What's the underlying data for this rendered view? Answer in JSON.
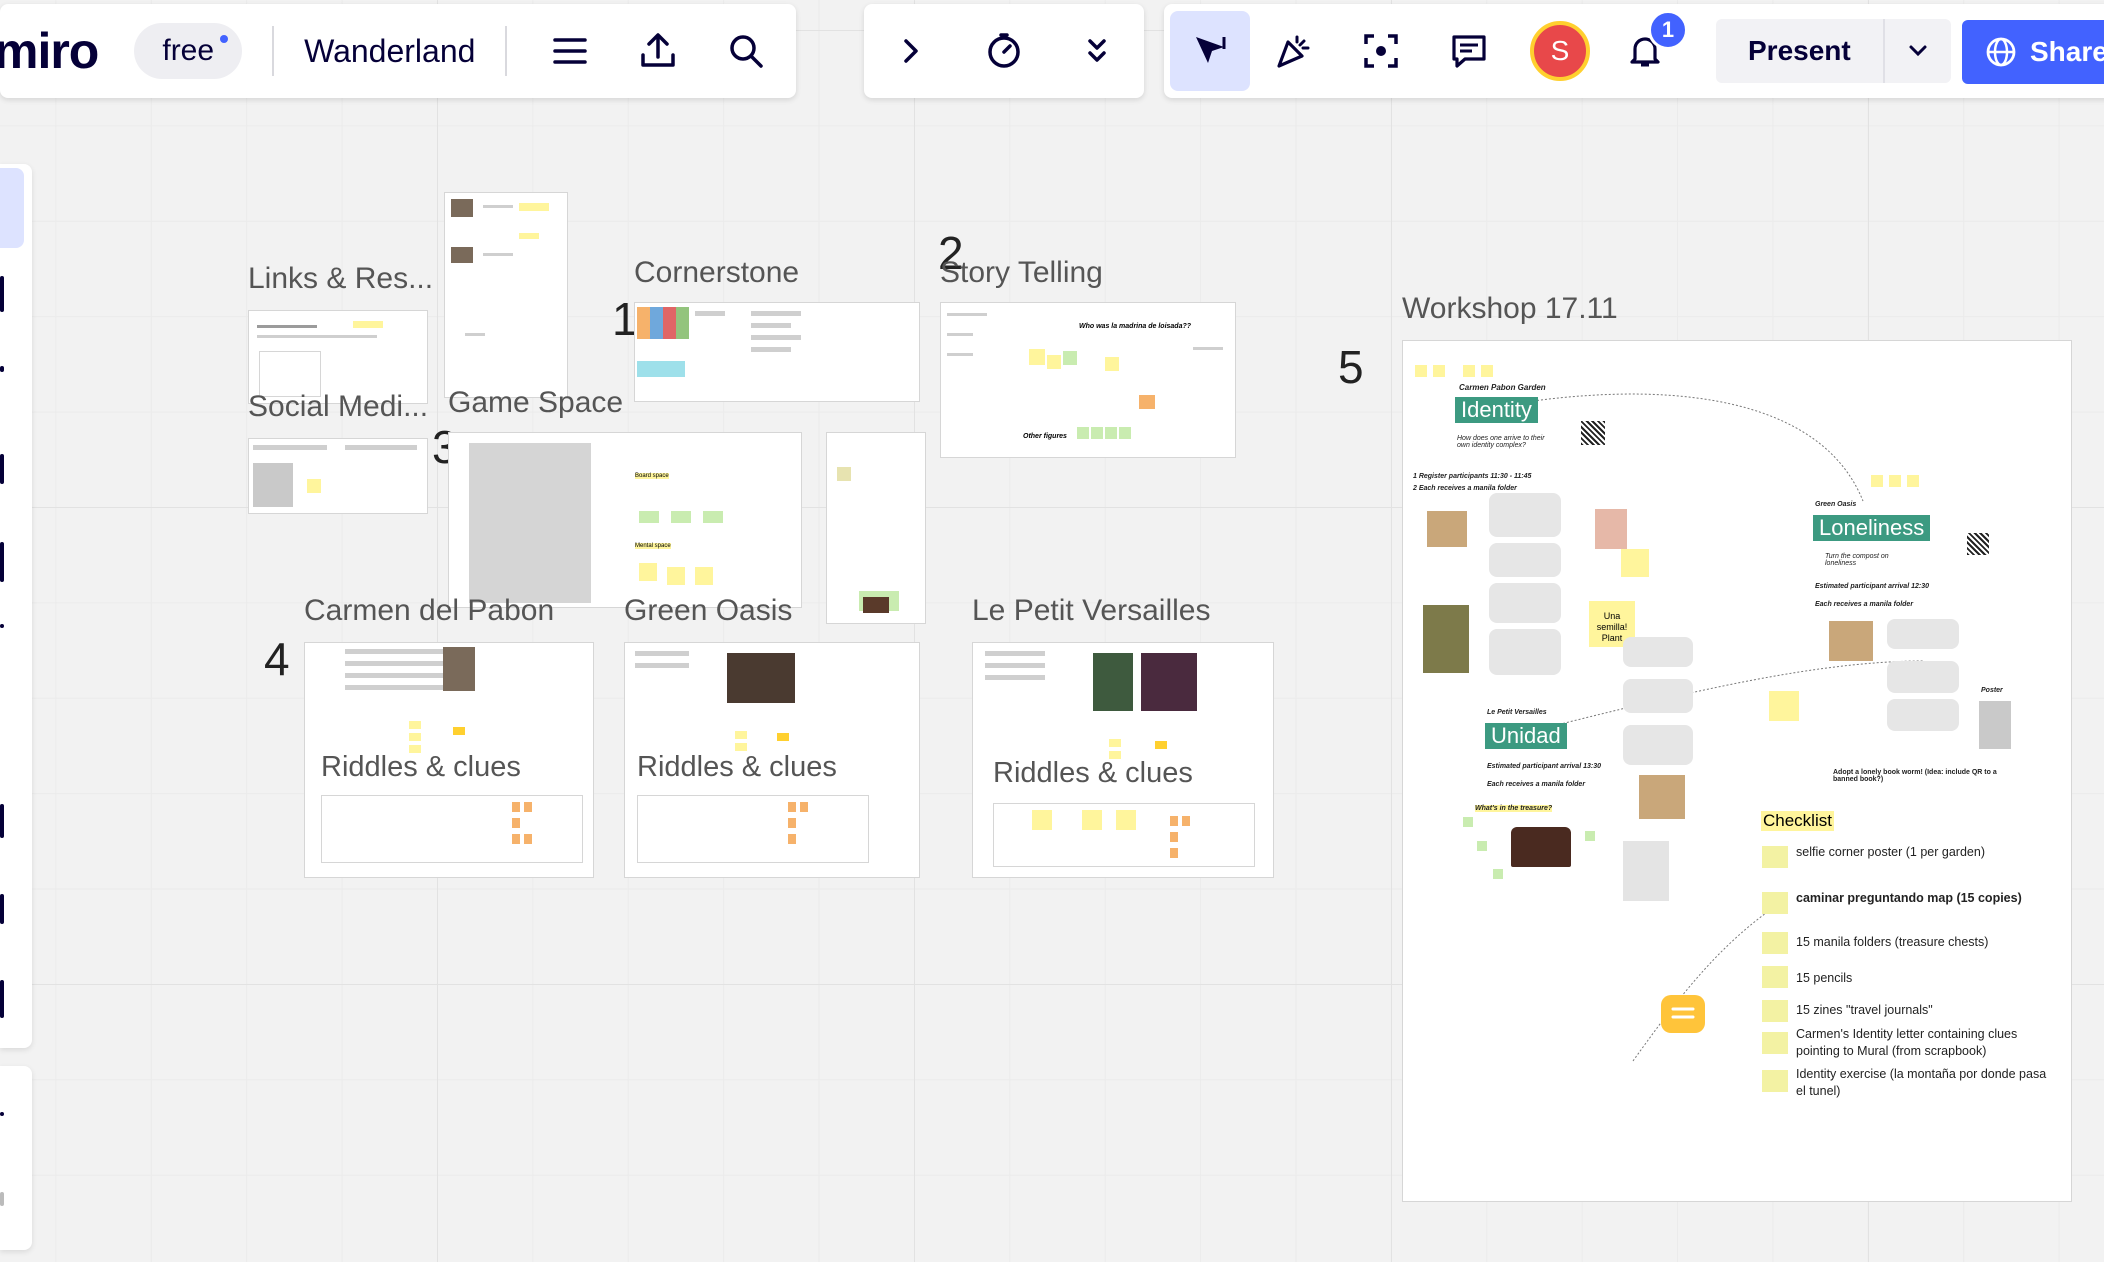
{
  "app": {
    "logo": "miro",
    "plan_badge": "free",
    "board_name": "Wanderland"
  },
  "toolbar": {
    "present_label": "Present",
    "share_label": "Share",
    "avatar_initial": "S",
    "notifications_count": "1"
  },
  "frames": {
    "links": "Links & Res...",
    "social": "Social Medi...",
    "cornerstone": "Cornerstone",
    "story": "Story Telling",
    "game": "Game Space",
    "carmen": "Carmen del Pabon",
    "green": "Green Oasis",
    "versailles": "Le Petit Versailles",
    "workshop": "Workshop 17.11"
  },
  "numbers": {
    "n1": "1",
    "n2": "2",
    "n3": "3",
    "n4": "4",
    "n5": "5"
  },
  "riddles": {
    "carmen": "Riddles & clues",
    "green": "Riddles & clues",
    "versailles": "Riddles & clues"
  },
  "story_board": {
    "headline": "Who was la madrina de loisada??",
    "other": "Other figures"
  },
  "game_board": {
    "board_space": "Board space",
    "mental_space": "Mental space"
  },
  "workshop": {
    "carmen_label": "Carmen Pabon Garden",
    "identity": "Identity",
    "identity_q": "How does one arrive to their own identity complex?",
    "register": "1 Register participants 11:30 - 11:45",
    "folder": "2 Each receives a manila folder",
    "green_label": "Green Oasis",
    "loneliness": "Loneliness",
    "loneliness_sub": "Turn the compost on loneliness",
    "arrival_green": "Estimated participant arrival 12:30",
    "folder_green": "Each receives a manila folder",
    "versailles_label": "Le Petit Versailles",
    "unidad": "Unidad",
    "arrival_unidad": "Estimated participant arrival 13:30",
    "folder_unidad": "Each receives a manila folder",
    "treasure": "What's in the treasure?",
    "sticky_note": "Una semilla! Plant",
    "adopt": "Adopt a lonely book worm! (Idea: include QR to a banned book?)",
    "poster": "Poster"
  },
  "checklist": {
    "title": "Checklist",
    "items": [
      "selfie corner poster (1 per garden)",
      "caminar preguntando map (15 copies)",
      "15 manila folders (treasure chests)",
      "15 pencils",
      "15 zines \"travel journals\"",
      "Carmen's Identity letter containing clues pointing to Mural (from scrapbook)",
      "Identity exercise (la montaña por donde pasa el tunel)"
    ]
  },
  "colors": {
    "brand_blue": "#4262ff",
    "sticky_yellow": "#fff59c",
    "sticky_orange": "#f6b26b",
    "tag_green": "#3c9a81"
  }
}
